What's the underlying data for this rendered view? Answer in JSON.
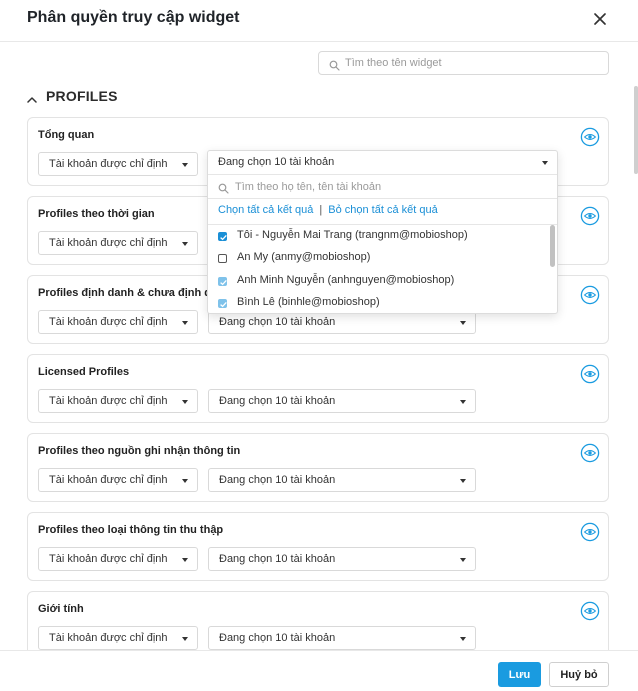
{
  "dialog": {
    "title": "Phân quyền truy cập widget",
    "close_icon": "close-icon"
  },
  "search": {
    "placeholder": "Tìm theo tên widget",
    "value": ""
  },
  "section": {
    "title": "PROFILES",
    "expanded": true
  },
  "colors": {
    "accent": "#1a9be0",
    "link": "#1a8fd6",
    "border": "#e3e3e3"
  },
  "widgets": [
    {
      "title": "Tổng quan",
      "scope": "Tài khoản được chỉ định",
      "accounts": "Đang chọn 10 tài khoản"
    },
    {
      "title": "Profiles theo thời gian",
      "scope": "Tài khoản được chỉ định",
      "accounts": "Đang chọn 10 tài khoản"
    },
    {
      "title": "Profiles định danh & chưa định danh",
      "scope": "Tài khoản được chỉ định",
      "accounts": "Đang chọn 10 tài khoản"
    },
    {
      "title": "Licensed Profiles",
      "scope": "Tài khoản được chỉ định",
      "accounts": "Đang chọn 10 tài khoản"
    },
    {
      "title": "Profiles theo nguồn ghi nhận thông tin",
      "scope": "Tài khoản được chỉ định",
      "accounts": "Đang chọn 10 tài khoản"
    },
    {
      "title": "Profiles theo loại thông tin thu thập",
      "scope": "Tài khoản được chỉ định",
      "accounts": "Đang chọn 10 tài khoản"
    },
    {
      "title": "Giới tính",
      "scope": "Tài khoản được chỉ định",
      "accounts": "Đang chọn 10 tài khoản"
    }
  ],
  "dropdown": {
    "selected_text": "Đang chọn 10 tài khoản",
    "search_placeholder": "Tìm theo họ tên, tên tài khoản",
    "select_all": "Chọn tất cả kết quả",
    "separator": "|",
    "deselect_all": "Bỏ chọn tất cả kết quả",
    "options": [
      {
        "label": "Tôi - Nguyễn Mai Trang (trangnm@mobioshop)",
        "checked": true
      },
      {
        "label": "An My (anmy@mobioshop)",
        "checked": false
      },
      {
        "label": "Anh Minh Nguyễn (anhnguyen@mobioshop)",
        "checked": true
      },
      {
        "label": "Bình Lê (binhle@mobioshop)",
        "checked": true
      }
    ]
  },
  "footer": {
    "save_label": "Lưu",
    "cancel_label": "Huỷ bỏ"
  }
}
